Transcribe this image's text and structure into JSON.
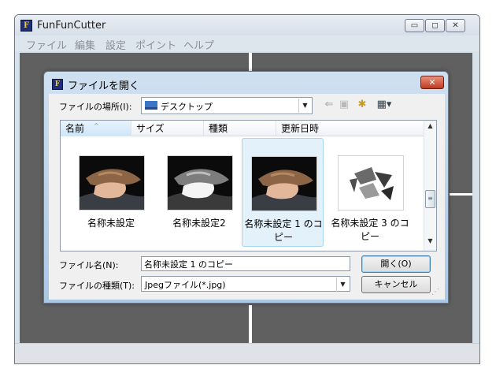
{
  "app": {
    "title": "FunFunCutter",
    "icon_glyph": "F",
    "window_buttons": {
      "minimize": "▭",
      "maximize": "◻",
      "close": "✕"
    }
  },
  "menu": [
    "ファイル",
    "編集",
    "設定",
    "ポイント",
    "ヘルプ"
  ],
  "dialog": {
    "title": "ファイルを開く",
    "close_glyph": "✕",
    "look_in_label": "ファイルの場所(I):",
    "look_in_value": "デスクトップ",
    "toolbar_icons": [
      "back-arrow-icon",
      "up-folder-icon",
      "new-folder-icon",
      "view-menu-icon"
    ],
    "columns": [
      "名前",
      "サイズ",
      "種類",
      "更新日時"
    ],
    "files": [
      {
        "name": "名称未設定",
        "selected": false
      },
      {
        "name": "名称未設定2",
        "selected": false
      },
      {
        "name": "名称未設定 1 のコピー",
        "selected": true
      },
      {
        "name": "名称未設定 3 のコピー",
        "selected": false
      }
    ],
    "filename_label": "ファイル名(N):",
    "filename_value": "名称未設定 1 のコピー",
    "filetype_label": "ファイルの種類(T):",
    "filetype_value": "Jpegファイル(*.jpg)",
    "open_button": "開く(O)",
    "cancel_button": "キャンセル"
  },
  "colors": {
    "canvas": "#606060",
    "selection": "#e3f1fb",
    "close_button": "#c0391f"
  }
}
